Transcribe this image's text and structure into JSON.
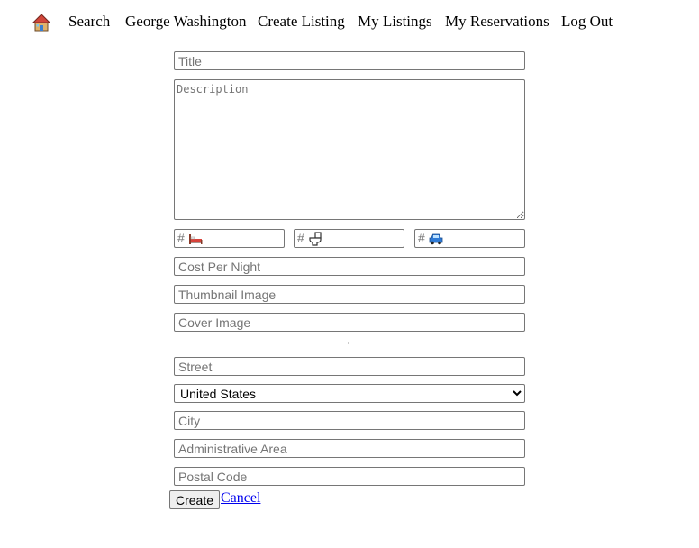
{
  "nav": {
    "home_icon": "house-icon",
    "search": "Search",
    "user_name": "George Washington",
    "create_listing": "Create Listing",
    "my_listings": "My Listings",
    "my_reservations": "My Reservations",
    "log_out": "Log Out"
  },
  "form": {
    "title_placeholder": "Title",
    "description_placeholder": "Description",
    "bedrooms": {
      "prefix": "#",
      "icon": "bed-icon"
    },
    "bathrooms": {
      "prefix": "#",
      "icon": "toilet-icon"
    },
    "parking": {
      "prefix": "#",
      "icon": "car-icon"
    },
    "cost_placeholder": "Cost Per Night",
    "thumbnail_placeholder": "Thumbnail Image",
    "cover_placeholder": "Cover Image",
    "street_placeholder": "Street",
    "country_selected": "United States",
    "city_placeholder": "City",
    "admin_area_placeholder": "Administrative Area",
    "postal_placeholder": "Postal Code",
    "create_label": "Create",
    "cancel_label": "Cancel"
  },
  "colors": {
    "link": "#0000ee",
    "border": "#767676",
    "placeholder": "#757575",
    "button_bg": "#efefef"
  }
}
